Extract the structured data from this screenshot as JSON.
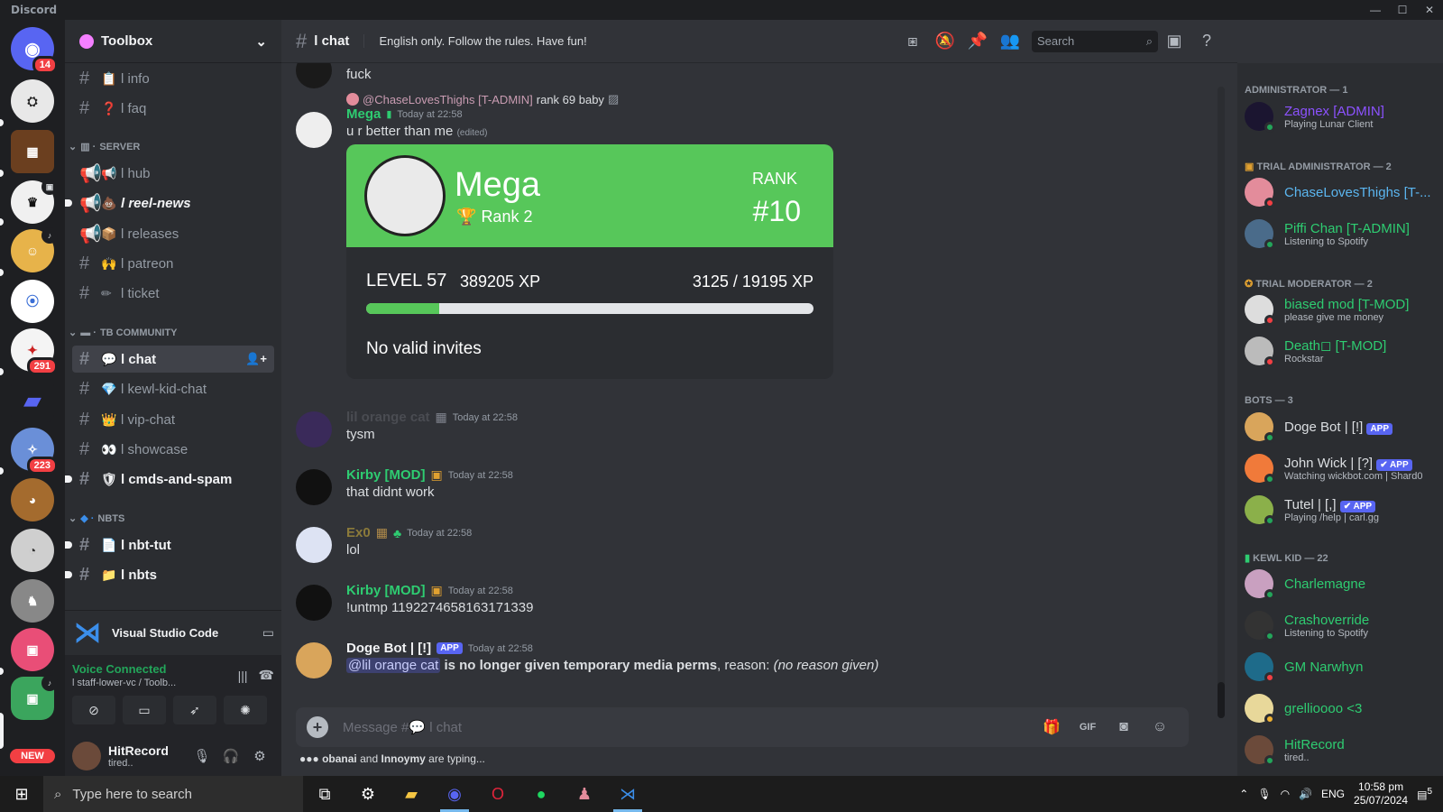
{
  "window": {
    "title": "Discord"
  },
  "guilds": {
    "home_badge": "14",
    "badges": [
      "291",
      "223"
    ],
    "new_label": "NEW"
  },
  "server": {
    "name": "Toolbox"
  },
  "channels": {
    "top": [
      {
        "emoji": "📋",
        "name": "l info"
      },
      {
        "emoji": "❓",
        "name": "l faq"
      }
    ],
    "cat_server": "SERVER",
    "server": [
      {
        "emoji": "📢",
        "name": "l hub"
      },
      {
        "emoji": "💩",
        "name": "l reel-news"
      },
      {
        "emoji": "📦",
        "name": "l releases"
      },
      {
        "emoji": "🙌",
        "name": "l patreon"
      },
      {
        "emoji": "✏",
        "name": "l ticket"
      }
    ],
    "cat_community": "TB COMMUNITY",
    "community": [
      {
        "emoji": "💬",
        "name": "l chat"
      },
      {
        "emoji": "💎",
        "name": "l kewl-kid-chat"
      },
      {
        "emoji": "👑",
        "name": "l vip-chat"
      },
      {
        "emoji": "👀",
        "name": "l showcase"
      },
      {
        "emoji": "🛡",
        "name": "l cmds-and-spam"
      }
    ],
    "cat_nbts": "NBTS",
    "nbts": [
      {
        "emoji": "📄",
        "name": "l nbt-tut"
      },
      {
        "emoji": "📁",
        "name": "l nbts"
      }
    ]
  },
  "activity": {
    "name": "Visual Studio Code"
  },
  "voice": {
    "status": "Voice Connected",
    "channel": "l staff-lower-vc / Toolb..."
  },
  "user": {
    "name": "HitRecord",
    "status": "tired.."
  },
  "header": {
    "channel": "l chat",
    "topic": "English only. Follow the rules. Have fun!",
    "search_placeholder": "Search"
  },
  "messages": {
    "m0_text": "fuck",
    "reply_author": "@ChaseLovesThighs [T-ADMIN]",
    "reply_text": "rank 69 baby",
    "mega_author": "Mega",
    "mega_ts": "Today at 22:58",
    "mega_text": "u r better than me",
    "mega_edited": "(edited)",
    "card": {
      "name": "Mega",
      "rank_label": "Rank 2",
      "rank_title": "RANK",
      "rank_num": "#10",
      "level": "LEVEL 57",
      "xp": "389205 XP",
      "progress_text": "3125 / 19195 XP",
      "progress": 0.163,
      "invites": "No valid invites"
    },
    "list": [
      {
        "author": "lil orange cat",
        "ts": "Today at 22:58",
        "text": "tysm",
        "color": "#3a3c42"
      },
      {
        "author": "Kirby [MOD]",
        "ts": "Today at 22:58",
        "text": "that didnt work",
        "color": "#2dc770"
      },
      {
        "author": "Ex0",
        "ts": "Today at 22:58",
        "text": "lol",
        "color": "#8b7a3a"
      },
      {
        "author": "Kirby [MOD]",
        "ts": "Today at 22:58",
        "text": "!untmp 1192274658163171339",
        "color": "#2dc770"
      }
    ],
    "doge_author": "Doge Bot | [!]",
    "doge_tag": "APP",
    "doge_ts": "Today at 22:58",
    "doge_mention": "@lil orange cat",
    "doge_bold": "is no longer given temporary media perms",
    "doge_reason": ", reason:",
    "doge_italic": "(no reason given)"
  },
  "composer": {
    "placeholder": "Message #💬 l chat"
  },
  "typing": {
    "names1": "obanai",
    "and": "and",
    "names2": "Innoymy",
    "suffix": "are typing..."
  },
  "members": {
    "roles": [
      {
        "title": "ADMINISTRATOR — 1"
      },
      {
        "title": "TRIAL ADMINISTRATOR — 2"
      },
      {
        "title": "TRIAL MODERATOR — 2"
      },
      {
        "title": "BOTS — 3"
      },
      {
        "title": "KEWL KID — 22"
      }
    ],
    "list": [
      {
        "name": "Zagnex [ADMIN]",
        "activity": "Playing Lunar Client",
        "color": "#8c52ff"
      },
      {
        "name": "ChaseLovesThighs [T-...",
        "activity": "",
        "color": "#5bb6f0"
      },
      {
        "name": "Piffi Chan [T-ADMIN]",
        "activity": "Listening to Spotify",
        "color": "#2ecc71"
      },
      {
        "name": "biased mod [T-MOD]",
        "activity": "please give me money",
        "color": "#2ecc71"
      },
      {
        "name": "Death◻ [T-MOD]",
        "activity": "Rockstar",
        "color": "#2ecc71"
      },
      {
        "name": "Doge Bot | [!]",
        "activity": "",
        "color": "#dbdee1"
      },
      {
        "name": "John Wick | [?]",
        "activity": "Watching wickbot.com | Shard0",
        "color": "#dbdee1"
      },
      {
        "name": "Tutel | [,]",
        "activity": "Playing /help | carl.gg",
        "color": "#dbdee1"
      },
      {
        "name": "Charlemagne",
        "activity": "",
        "color": "#2ecc71"
      },
      {
        "name": "Crashoverride",
        "activity": "Listening to Spotify",
        "color": "#2ecc71"
      },
      {
        "name": "GM Narwhyn",
        "activity": "",
        "color": "#2ecc71"
      },
      {
        "name": "grellioooo <3",
        "activity": "",
        "color": "#2ecc71"
      },
      {
        "name": "HitRecord",
        "activity": "tired..",
        "color": "#2ecc71"
      }
    ],
    "app_tag": "APP",
    "app_tag_check": "✔ APP"
  },
  "taskbar": {
    "search_placeholder": "Type here to search",
    "lang": "ENG",
    "time": "10:58 pm",
    "date": "25/07/2024",
    "notif_count": "5"
  }
}
